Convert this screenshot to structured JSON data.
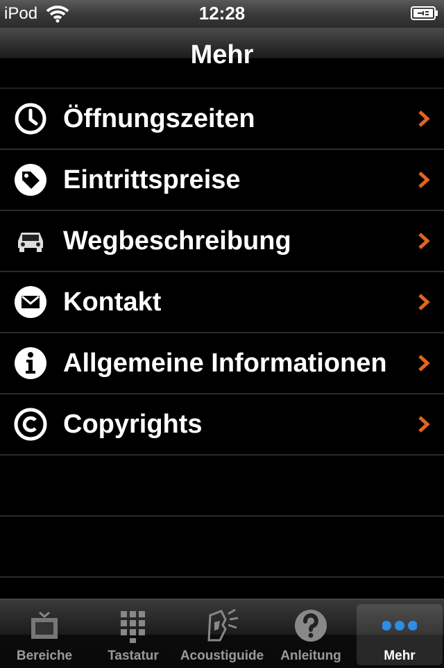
{
  "status_bar": {
    "carrier": "iPod",
    "time": "12:28"
  },
  "navbar": {
    "title": "Mehr"
  },
  "menu": {
    "items": [
      {
        "label": "Öffnungszeiten",
        "icon": "clock-icon"
      },
      {
        "label": "Eintrittspreise",
        "icon": "price-tag-icon"
      },
      {
        "label": "Wegbeschreibung",
        "icon": "car-icon"
      },
      {
        "label": "Kontakt",
        "icon": "envelope-icon"
      },
      {
        "label": "Allgemeine Informationen",
        "icon": "info-icon"
      },
      {
        "label": "Copyrights",
        "icon": "copyright-icon"
      }
    ]
  },
  "tabbar": {
    "tabs": [
      {
        "label": "Bereiche",
        "icon": "picture-frame-icon"
      },
      {
        "label": "Tastatur",
        "icon": "keypad-icon"
      },
      {
        "label": "Acoustiguide",
        "icon": "acoustiguide-icon"
      },
      {
        "label": "Anleitung",
        "icon": "question-icon"
      },
      {
        "label": "Mehr",
        "icon": "more-dots-icon",
        "selected": true
      }
    ]
  },
  "colors": {
    "accent_chevron": "#e0651f",
    "selected_dots": "#2f8be8"
  }
}
